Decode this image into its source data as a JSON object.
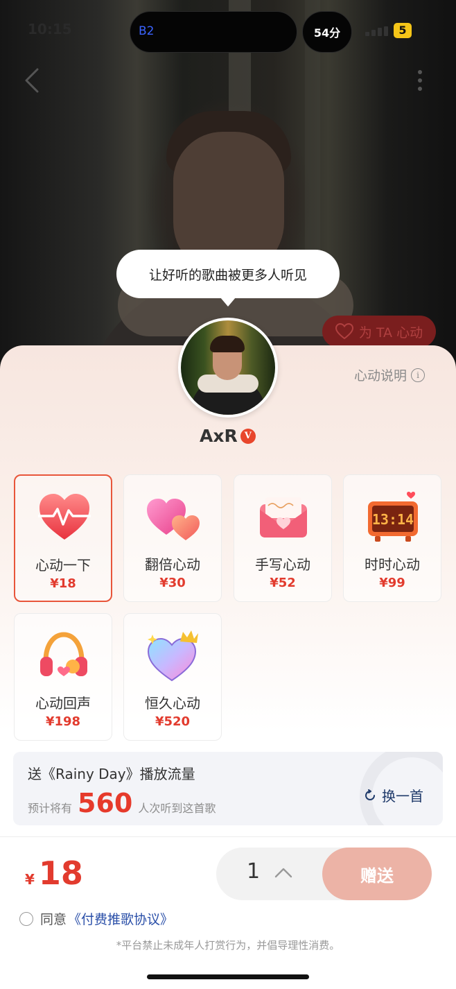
{
  "status_bar": {
    "time": "10:15",
    "island_label": "B2",
    "timer": "54分",
    "battery": "5"
  },
  "hero": {
    "bubble_text": "让好听的歌曲被更多人听见",
    "heart_button_label": "为 TA 心动"
  },
  "sheet": {
    "explain_label": "心动说明",
    "username": "AxR",
    "verified_badge": "V",
    "gifts": [
      {
        "name": "心动一下",
        "price": "¥18",
        "selected": true,
        "icon": "heart-pulse-icon"
      },
      {
        "name": "翻倍心动",
        "price": "¥30",
        "selected": false,
        "icon": "double-heart-icon"
      },
      {
        "name": "手写心动",
        "price": "¥52",
        "selected": false,
        "icon": "love-letter-icon"
      },
      {
        "name": "时时心动",
        "price": "¥99",
        "selected": false,
        "icon": "clock-icon"
      },
      {
        "name": "心动回声",
        "price": "¥198",
        "selected": false,
        "icon": "headphones-icon"
      },
      {
        "name": "恒久心动",
        "price": "¥520",
        "selected": false,
        "icon": "crown-heart-icon"
      }
    ],
    "song": {
      "title": "送《Rainy Day》播放流量",
      "sub_prefix": "预计将有",
      "count": "560",
      "sub_suffix": "人次听到这首歌",
      "switch_label": "换一首"
    },
    "footer": {
      "currency": "¥",
      "total": "18",
      "quantity": "1",
      "send_label": "赠送",
      "agree_prefix": "同意",
      "agree_link": "《付费推歌协议》",
      "notice": "*平台禁止未成年人打赏行为，并倡导理性消费。"
    }
  },
  "colors": {
    "accent": "#e23b2e",
    "send_button": "#ecb3a6",
    "link": "#2a4fa8"
  }
}
